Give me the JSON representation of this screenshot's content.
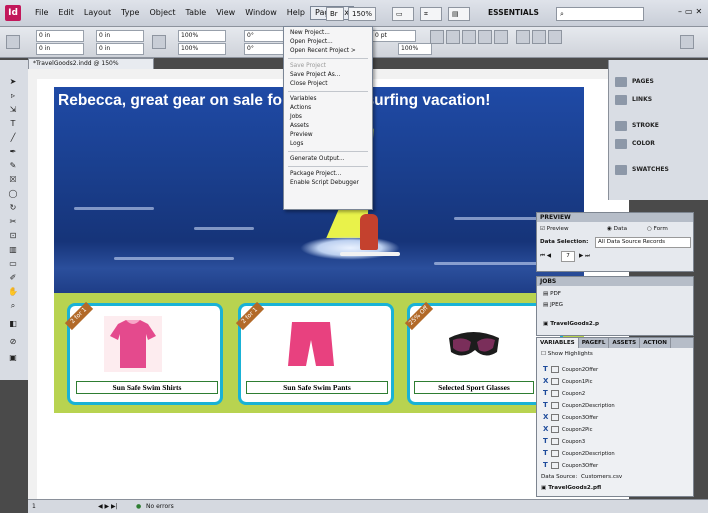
{
  "menubar": {
    "app_label": "Id",
    "items": [
      "File",
      "Edit",
      "Layout",
      "Type",
      "Object",
      "Table",
      "View",
      "Window",
      "Help",
      "Pageflex"
    ],
    "active": "Pageflex",
    "zoom": "150%",
    "workspace": "ESSENTIALS"
  },
  "controlbar": {
    "x": "0 in",
    "y": "0 in",
    "w": "0 in",
    "h": "0 in",
    "scale_x": "100%",
    "scale_y": "100%",
    "angle": "0°",
    "shear": "0°",
    "stroke": "0 pt",
    "stroke_pct": "100%"
  },
  "document": {
    "tab_title": "*TravelGoods2.indd @ 150%",
    "headline": "Rebecca, great gear on sale for your windsurfing vacation!",
    "colors": {
      "band": "#b8d350",
      "card_border": "#19b2d6",
      "tag": "#b26a29"
    }
  },
  "products": [
    {
      "tag": "2 for 1",
      "caption": "Sun Safe Swim Shirts",
      "icon": "swim-shirt"
    },
    {
      "tag": "2 for 1",
      "caption": "Sun Safe Swim Pants",
      "icon": "swim-pants"
    },
    {
      "tag": "25% Off",
      "caption": "Selected Sport Glasses",
      "icon": "sport-glasses"
    }
  ],
  "pageflex_menu": {
    "items": [
      {
        "label": "New Project...",
        "disabled": false
      },
      {
        "label": "Open Project...",
        "disabled": false
      },
      {
        "label": "Open Recent Project >",
        "disabled": false
      },
      {
        "label": "Save Project",
        "disabled": true
      },
      {
        "label": "Save Project As...",
        "disabled": false
      },
      {
        "label": "Close Project",
        "disabled": false
      },
      {
        "label": "Variables",
        "disabled": false
      },
      {
        "label": "Actions",
        "disabled": false
      },
      {
        "label": "Jobs",
        "disabled": false
      },
      {
        "label": "Assets",
        "disabled": false
      },
      {
        "label": "Preview",
        "disabled": false
      },
      {
        "label": "Logs",
        "disabled": false
      },
      {
        "label": "Generate Output...",
        "disabled": false
      },
      {
        "label": "Package Project...",
        "disabled": false
      },
      {
        "label": "Enable Script Debugger",
        "disabled": false
      }
    ]
  },
  "dock": {
    "items": [
      {
        "label": "PAGES",
        "icon": "pages-icon"
      },
      {
        "label": "LINKS",
        "icon": "links-icon"
      },
      {
        "label": "STROKE",
        "icon": "stroke-icon"
      },
      {
        "label": "COLOR",
        "icon": "color-icon"
      },
      {
        "label": "SWATCHES",
        "icon": "swatches-icon"
      }
    ]
  },
  "preview_panel": {
    "title": "PREVIEW",
    "preview_label": "Preview",
    "radio_data": "Data",
    "radio_form": "Form",
    "selection_label": "Data Selection:",
    "selection_value": "All Data Source Records",
    "record": "7"
  },
  "jobs_panel": {
    "title": "JOBS",
    "items": [
      "PDF",
      "JPEG"
    ],
    "project": "TravelGoods2.p"
  },
  "variables_panel": {
    "tabs": [
      "VARIABLES",
      "PAGEFL",
      "ASSETS",
      "ACTION"
    ],
    "show_highlights": "Show Highlights",
    "rows": [
      {
        "type": "T",
        "name": "Coupon2Offer"
      },
      {
        "type": "X",
        "name": "Coupon1Pic"
      },
      {
        "type": "T",
        "name": "Coupon2"
      },
      {
        "type": "T",
        "name": "Coupon2Description"
      },
      {
        "type": "X",
        "name": "Coupon3Offer"
      },
      {
        "type": "X",
        "name": "Coupon2Pic"
      },
      {
        "type": "T",
        "name": "Coupon3"
      },
      {
        "type": "T",
        "name": "Coupon2Description"
      },
      {
        "type": "T",
        "name": "Coupon3Offer"
      }
    ],
    "data_source_label": "Data Source:",
    "data_source_value": "Customers.csv",
    "project_file": "TravelGoods2.pfl"
  },
  "statusbar": {
    "page": "1",
    "errors": "No errors"
  }
}
